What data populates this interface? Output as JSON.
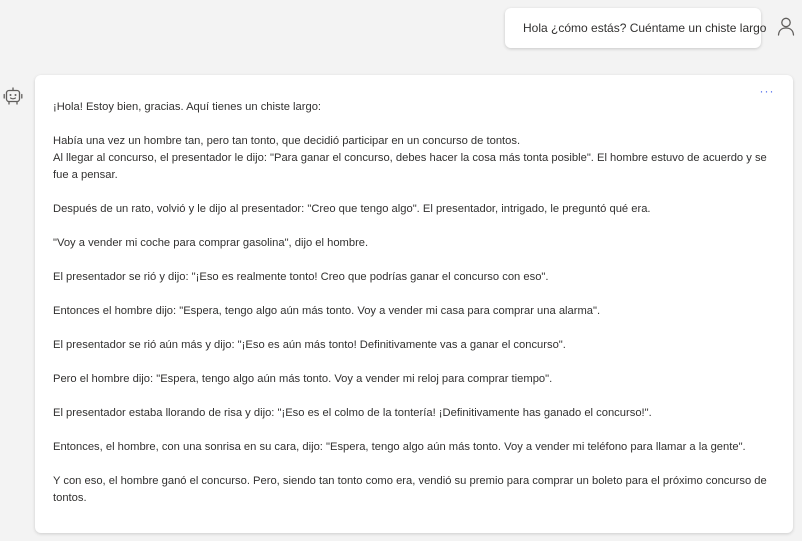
{
  "user_message": {
    "text": "Hola ¿cómo estás? Cuéntame un chiste largo",
    "avatar_icon": "user-icon"
  },
  "bot_message": {
    "avatar_icon": "bot-icon",
    "more_label": "···",
    "intro": "¡Hola! Estoy bien, gracias. Aquí tienes un chiste largo:",
    "story_line_1": "Había una vez un hombre tan, pero tan tonto, que decidió participar en un concurso de tontos.",
    "story_line_2": "Al llegar al concurso, el presentador le dijo: \"Para ganar el concurso, debes hacer la cosa más tonta posible\". El hombre estuvo de acuerdo y se fue a pensar.",
    "p3": "Después de un rato, volvió y le dijo al presentador: \"Creo que tengo algo\". El presentador, intrigado, le preguntó qué era.",
    "p4": "\"Voy a vender mi coche para comprar gasolina\", dijo el hombre.",
    "p5": "El presentador se rió y dijo: \"¡Eso es realmente tonto! Creo que podrías ganar el concurso con eso\".",
    "p6": "Entonces el hombre dijo: \"Espera, tengo algo aún más tonto. Voy a vender mi casa para comprar una alarma\".",
    "p7": "El presentador se rió aún más y dijo: \"¡Eso es aún más tonto! Definitivamente vas a ganar el concurso\".",
    "p8": "Pero el hombre dijo: \"Espera, tengo algo aún más tonto. Voy a vender mi reloj para comprar tiempo\".",
    "p9": "El presentador estaba llorando de risa y dijo: \"¡Eso es el colmo de la tontería! ¡Definitivamente has ganado el concurso!\".",
    "p10": "Entonces, el hombre, con una sonrisa en su cara, dijo: \"Espera, tengo algo aún más tonto. Voy a vender mi teléfono para llamar a la gente\".",
    "p11": "Y con eso, el hombre ganó el concurso. Pero, siendo tan tonto como era, vendió su premio para comprar un boleto para el próximo concurso de tontos."
  },
  "colors": {
    "background": "#f3f3f3",
    "bubble": "#ffffff",
    "text": "#323130",
    "accent": "#4f6bed",
    "icon": "#605e5c"
  }
}
